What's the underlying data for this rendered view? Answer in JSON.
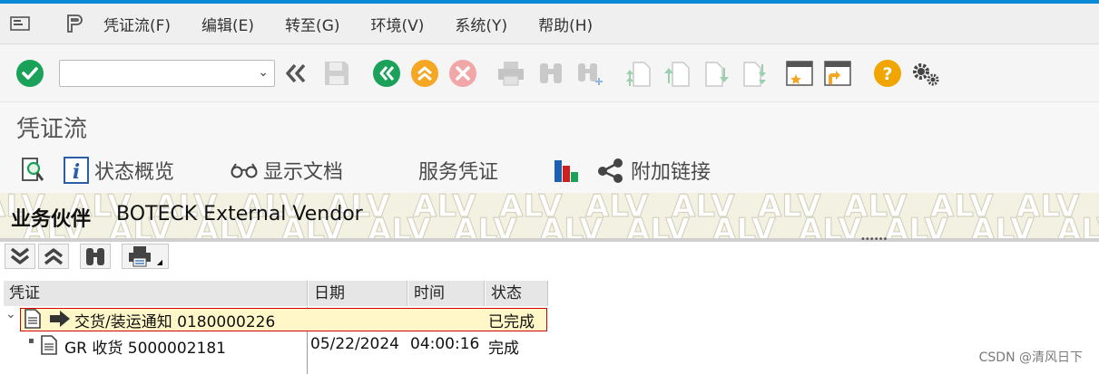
{
  "menu": {
    "items": [
      {
        "label": "凭证流(F)"
      },
      {
        "label": "编辑(E)"
      },
      {
        "label": "转至(G)"
      },
      {
        "label": "环境(V)"
      },
      {
        "label": "系统(Y)"
      },
      {
        "label": "帮助(H)"
      }
    ]
  },
  "toolbar": {
    "command_value": "",
    "icons": [
      "enter-check-icon",
      "back-icon",
      "save-icon",
      "green-back-icon",
      "exit-up-icon",
      "cancel-icon",
      "print-icon",
      "find-icon",
      "find-next-icon",
      "first-page-icon",
      "previous-page-icon",
      "next-page-icon",
      "last-page-icon",
      "create-session-icon",
      "shortcut-icon",
      "help-icon",
      "settings-icon"
    ]
  },
  "title": "凭证流",
  "app_toolbar": {
    "status_overview": "状态概览",
    "display_document": "显示文档",
    "service_document": "服务凭证",
    "additional_links": "附加链接"
  },
  "alv_header": {
    "watermark": "ALV",
    "partner_label": "业务伙伴",
    "partner_value": "BOTECK External Vendor"
  },
  "table": {
    "columns": [
      "凭证",
      "日期",
      "时间",
      "状态"
    ],
    "rows": [
      {
        "document": "交货/装运通知 0180000226",
        "date": "",
        "time": "",
        "status": "已完成",
        "expanded": true
      },
      {
        "document": "GR 收货 5000002181",
        "date": "05/22/2024",
        "time": "04:00:16",
        "status": "完成"
      }
    ]
  },
  "watermark_text": "CSDN @清风日下",
  "colors": {
    "accent": "#0a8ad6",
    "green": "#1aa25a",
    "orange": "#f5a623",
    "header_bg": "#f3f1e2",
    "highlight_bg": "#fff7c8",
    "highlight_border": "#d30000"
  }
}
